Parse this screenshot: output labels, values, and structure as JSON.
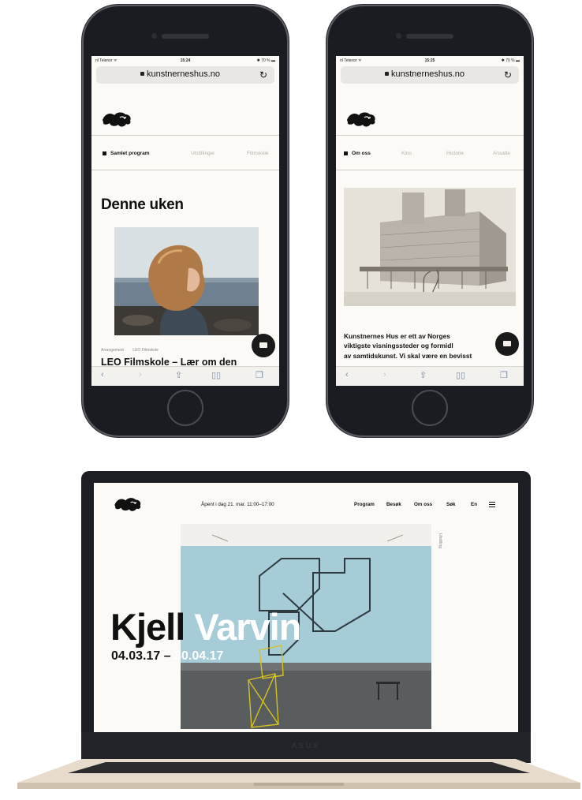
{
  "phone_left": {
    "status": {
      "carrier": "nl Telenor ᯤ",
      "time": "15:24",
      "battery": "✱ 70 % ▬"
    },
    "url": "kunstnerneshus.no",
    "tabs": [
      "Samlet program",
      "Utstillinger",
      "Filmskole"
    ],
    "heading": "Denne uken",
    "meta": [
      "Arrangement",
      "LEO Filmskole"
    ],
    "card_title": "LEO Filmskole – Lær om den"
  },
  "phone_right": {
    "status": {
      "carrier": "nl Telenor ᯤ",
      "time": "15:25",
      "battery": "✱ 70 % ▬"
    },
    "url": "kunstnerneshus.no",
    "tabs": [
      "Om oss",
      "Kino",
      "Historie",
      "Ansatte"
    ],
    "intro_lines": [
      "Kunstnernes Hus er ett av Norges",
      "viktigste visningssteder og formidl",
      "av samtidskunst. Vi skal være en bevisst"
    ]
  },
  "laptop": {
    "brand": "ASUS",
    "opening_hours": "Åpent i dag 21. mar. 11:00–17:00",
    "nav": [
      "Program",
      "Besøk",
      "Om oss",
      "Søk",
      "En"
    ],
    "hero_title_dark": "Kjell",
    "hero_title_light": "Varvin",
    "hero_dates_dark": "04.03.17 – ",
    "hero_dates_light": "30.04.17",
    "side_label": "Utstilling"
  },
  "colors": {
    "background": "#fbfaf6",
    "text": "#111111",
    "muted": "#b3b1ab",
    "device": "#1b1c22"
  }
}
